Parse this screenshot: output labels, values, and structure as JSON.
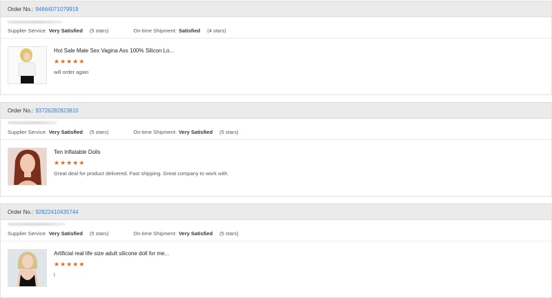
{
  "order_label": "Order No.:",
  "supplier_label": "Supplier Service:",
  "shipment_label": "On-time Shipment:",
  "accent": "#2a7fd4",
  "star_color": "#f2630f",
  "orders": [
    {
      "order_no": "94664071079919",
      "supplier_value": "Very Satisfied",
      "supplier_stars": "(5 stars)",
      "shipment_value": "Satisfied",
      "shipment_stars": "(4 stars)",
      "product_title": "Hot Sale Male Sex Vagina Ass 100% Silicon Lo...",
      "rating": 5,
      "review": "will order again"
    },
    {
      "order_no": "93726282823810",
      "supplier_value": "Very Satisfied",
      "supplier_stars": "(5 stars)",
      "shipment_value": "Very Satisfied",
      "shipment_stars": "(5 stars)",
      "product_title": "Ten Inflatable Dolls",
      "rating": 5,
      "review": "Great deal for product delivered. Fast shipping. Great company to work with."
    },
    {
      "order_no": "92822410435744",
      "supplier_value": "Very Satisfied",
      "supplier_stars": "(5 stars)",
      "shipment_value": "Very Satisfied",
      "shipment_stars": "(5 stars)",
      "product_title": "Artificial real life size adult silicone doll for me...",
      "rating": 5,
      "review": "l"
    }
  ]
}
